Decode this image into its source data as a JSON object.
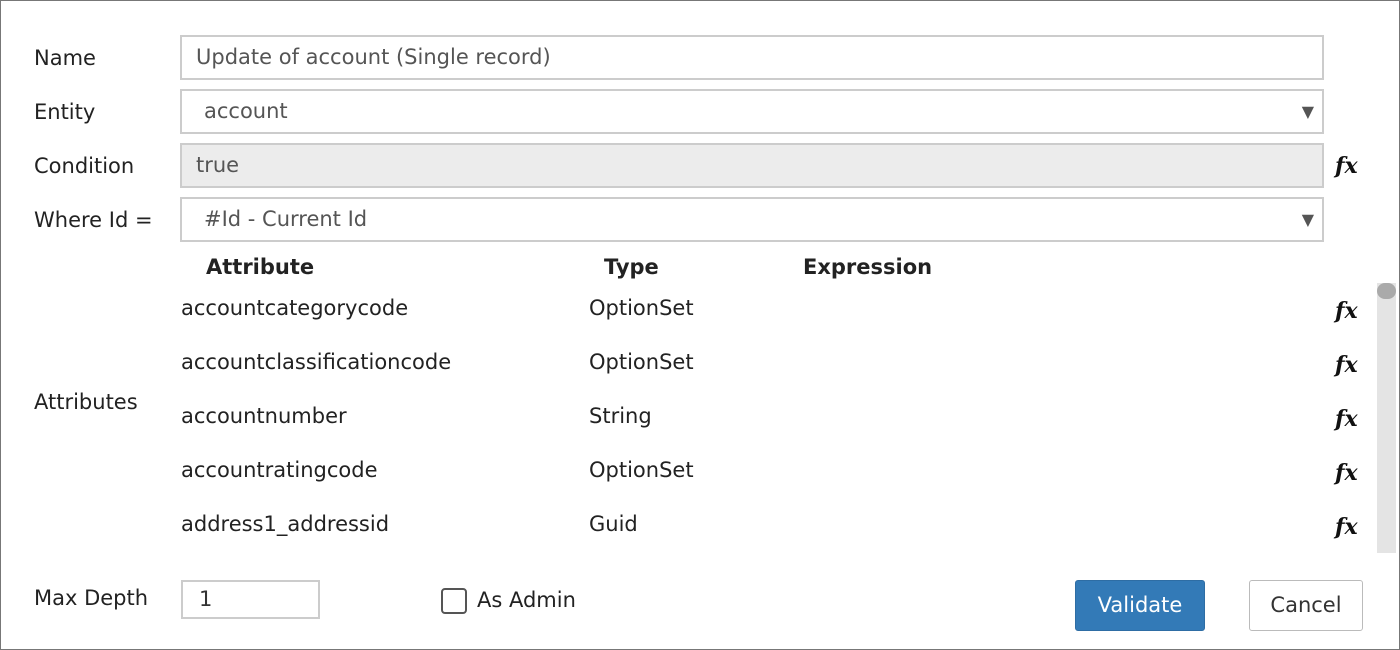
{
  "form": {
    "name_label": "Name",
    "name_value": "Update of account (Single record)",
    "entity_label": "Entity",
    "entity_value": "account",
    "condition_label": "Condition",
    "condition_value": "true",
    "whereid_label": "Where Id =",
    "whereid_value": "#Id - Current Id",
    "attributes_label": "Attributes",
    "columns": [
      "Attribute",
      "Type",
      "Expression"
    ],
    "rows": [
      {
        "attribute": "accountcategorycode",
        "type": "OptionSet"
      },
      {
        "attribute": "accountclassificationcode",
        "type": "OptionSet"
      },
      {
        "attribute": "accountnumber",
        "type": "String"
      },
      {
        "attribute": "accountratingcode",
        "type": "OptionSet"
      },
      {
        "attribute": "address1_addressid",
        "type": "Guid"
      }
    ],
    "maxdepth_label": "Max Depth",
    "maxdepth_value": "1",
    "asadmin_label": "As Admin",
    "validate_label": "Validate",
    "cancel_label": "Cancel",
    "fx_symbol": "fx"
  },
  "colors": {
    "primary": "#337ab7"
  }
}
